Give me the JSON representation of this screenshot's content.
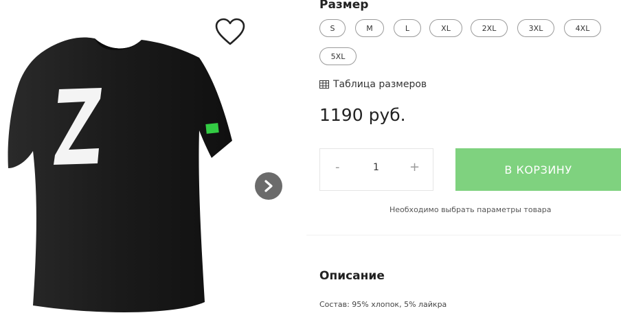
{
  "product": {
    "image_alt": "Черная футболка с буквой Z",
    "favorite_icon": "heart-icon",
    "next_icon": "chevron-right-icon"
  },
  "size": {
    "label": "Размер",
    "options": [
      "S",
      "M",
      "L",
      "XL",
      "2XL",
      "3XL",
      "4XL",
      "5XL"
    ],
    "table_link": "Таблица размеров"
  },
  "price": "1190 руб.",
  "quantity": {
    "minus": "-",
    "value": "1",
    "plus": "+"
  },
  "cart_button": "В КОРЗИНУ",
  "hint": "Необходимо выбрать параметры товара",
  "description": {
    "title": "Описание",
    "text": "Состав: 95% хлопок, 5% лайкра"
  },
  "colors": {
    "accent": "#7fd27f",
    "chip_border": "#9a9a9a",
    "arrow_bg": "#6b6b6b"
  }
}
